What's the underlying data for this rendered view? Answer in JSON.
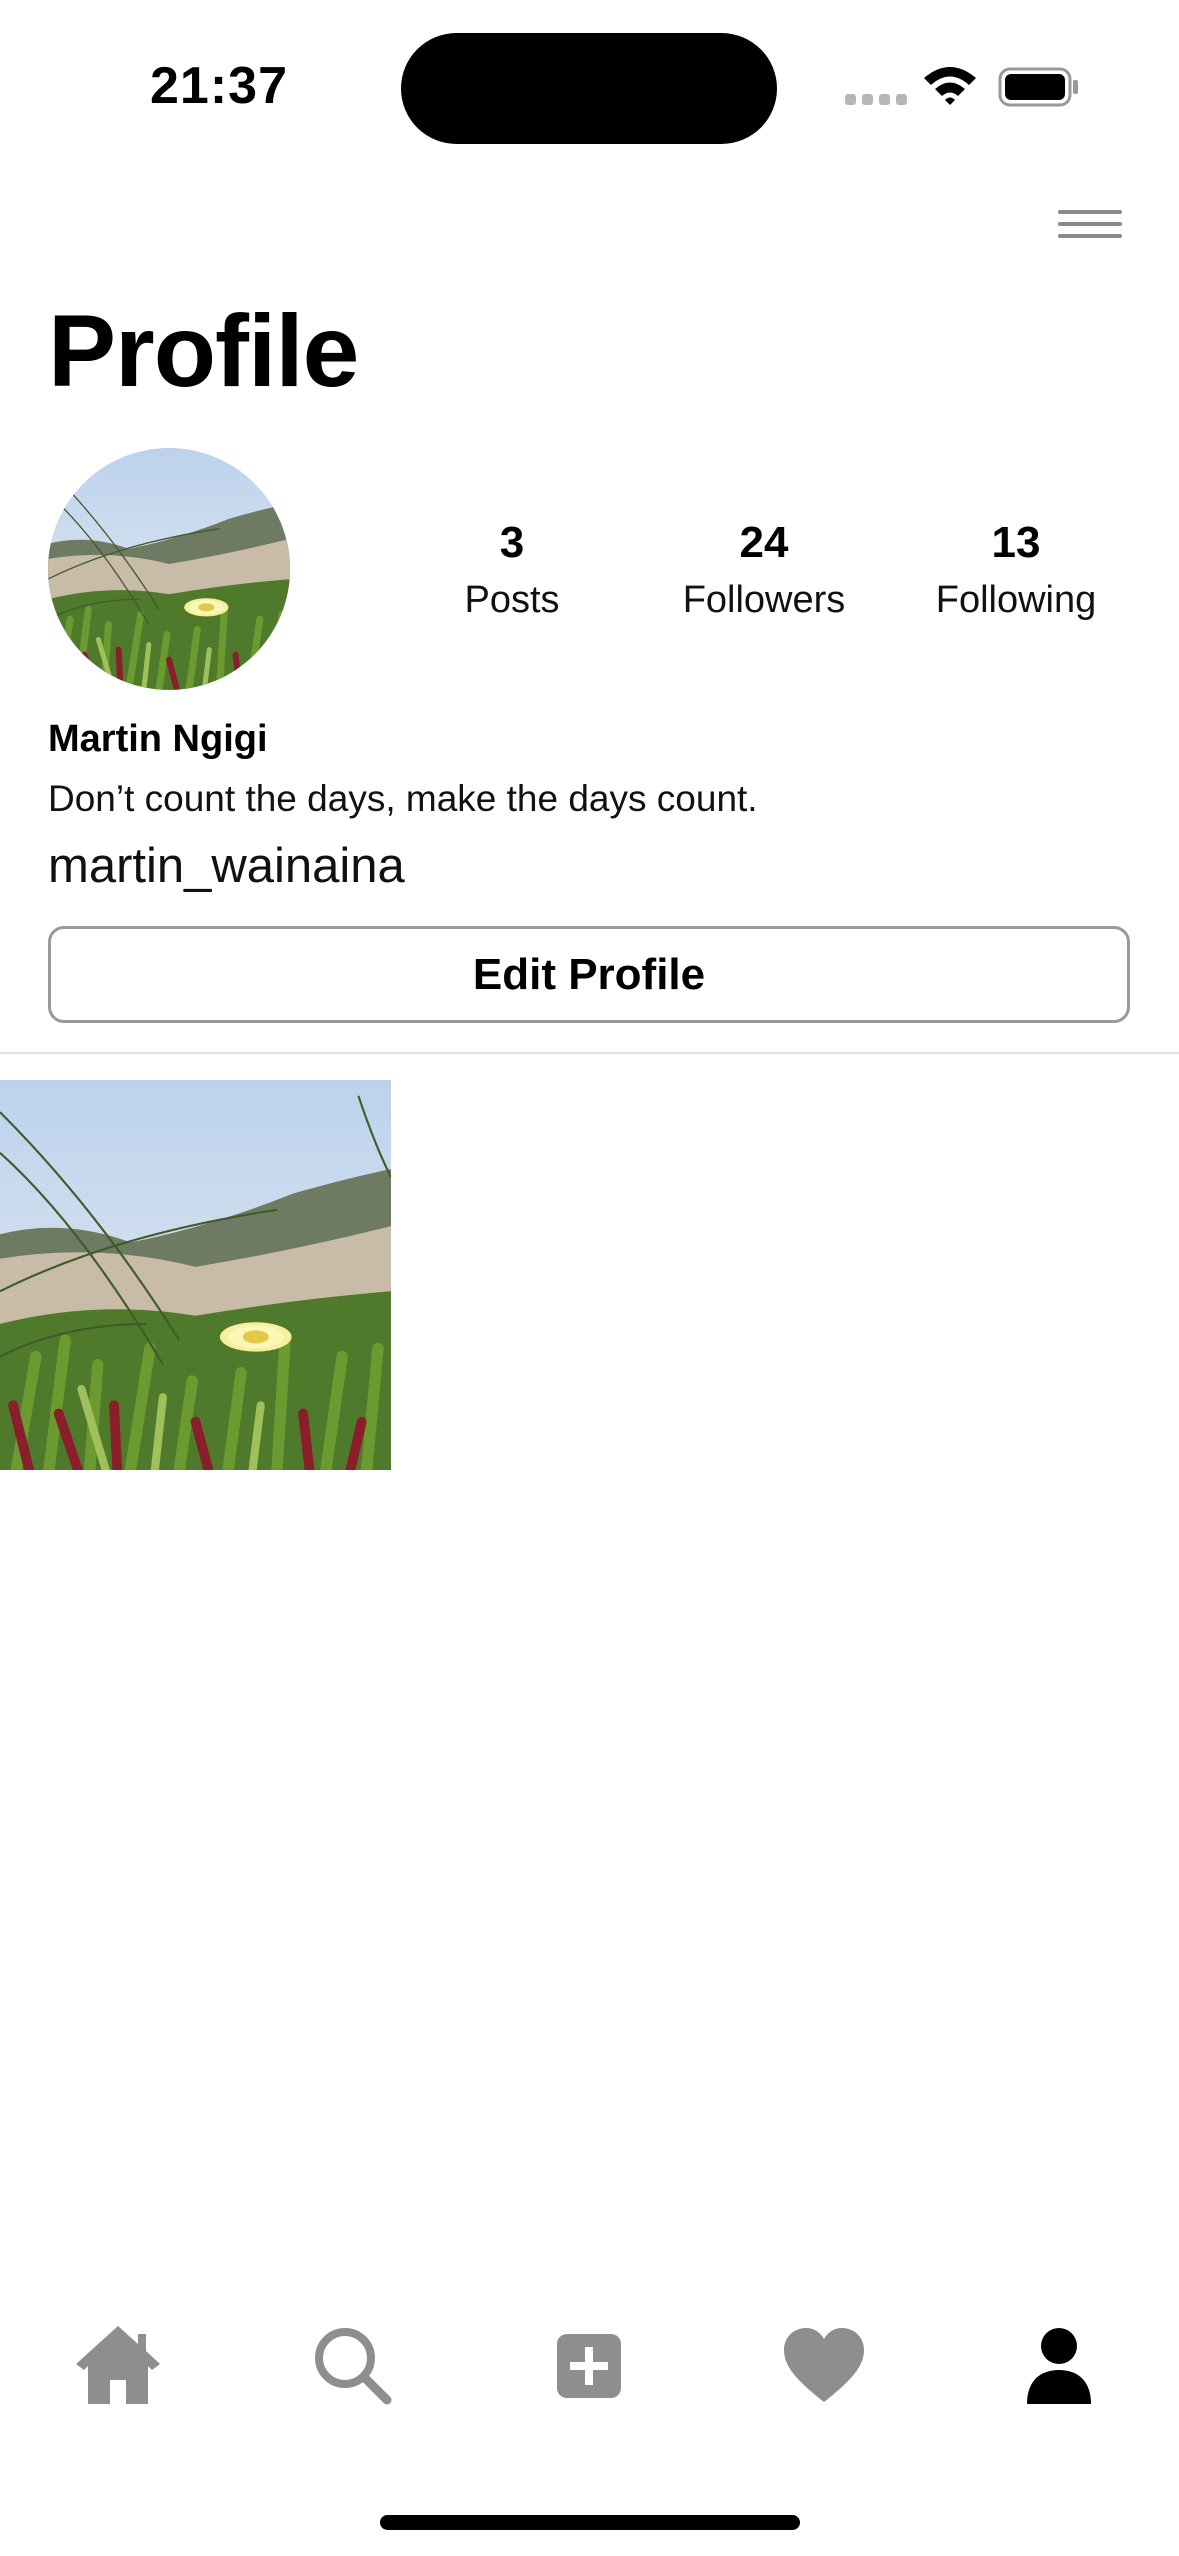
{
  "status_bar": {
    "time": "21:37",
    "icons": [
      "signal-dots-icon",
      "wifi-icon",
      "battery-icon"
    ]
  },
  "header": {
    "menu_icon": "hamburger-menu-icon",
    "title": "Profile"
  },
  "profile": {
    "avatar": "profile-photo (yellow flower in green ice plants)",
    "stats": [
      {
        "value": "3",
        "label": "Posts"
      },
      {
        "value": "24",
        "label": "Followers"
      },
      {
        "value": "13",
        "label": "Following"
      }
    ],
    "full_name": "Martin Ngigi",
    "bio": "Don’t count the days, make the days count.",
    "username": "martin_wainaina",
    "edit_button_label": "Edit Profile"
  },
  "posts": [
    {
      "image": "yellow flower in green and red ice plants"
    }
  ],
  "tab_bar": {
    "items": [
      {
        "icon": "home-icon",
        "active": false
      },
      {
        "icon": "search-icon",
        "active": false
      },
      {
        "icon": "add-post-icon",
        "active": false
      },
      {
        "icon": "heart-icon",
        "active": false
      },
      {
        "icon": "profile-icon",
        "active": true
      }
    ]
  },
  "colors": {
    "inactive_icon": "#8e8e8e",
    "active_icon": "#000000",
    "button_border": "#9a9a9a",
    "divider": "#e2e2e2"
  }
}
